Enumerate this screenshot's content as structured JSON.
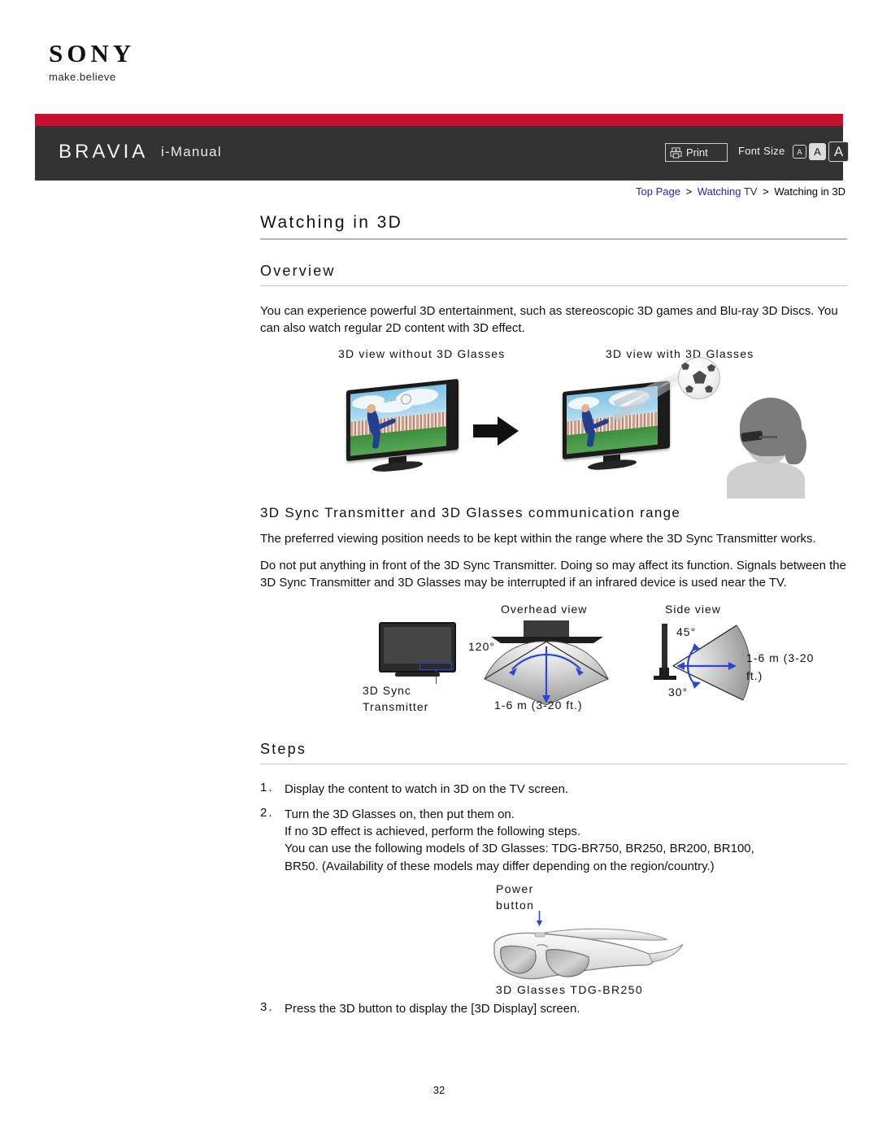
{
  "logo": {
    "brand": "SONY",
    "tagline": "make.believe"
  },
  "header": {
    "product": "BRAVIA",
    "manual": "i-Manual",
    "print_label": "Print",
    "print_icon": "printer-icon",
    "font_size_label": "Font Size",
    "font_size_options": [
      "A",
      "A",
      "A"
    ],
    "font_size_selected_index": 1,
    "bar_color": "#333333",
    "accent_color": "#c8102e"
  },
  "breadcrumb": {
    "items": [
      {
        "label": "Top Page",
        "is_link": true
      },
      {
        "label": "Watching TV",
        "is_link": true
      },
      {
        "label": "Watching in 3D",
        "is_link": false
      }
    ],
    "separator": ">",
    "link_color": "#2222cc"
  },
  "page": {
    "title": "Watching in 3D",
    "number": "32"
  },
  "overview": {
    "heading": "Overview",
    "paragraph": "You can experience powerful 3D entertainment, such as stereoscopic 3D games and Blu-ray 3D Discs. You can also watch regular 2D content with 3D effect.",
    "figure": {
      "caption_left": "3D view without 3D Glasses",
      "caption_right": "3D view with 3D Glasses"
    }
  },
  "comm_range": {
    "heading": "3D Sync Transmitter and 3D Glasses communication range",
    "paragraph_1": "The preferred viewing position needs to be kept within the range where the 3D Sync Transmitter works.",
    "paragraph_2": "Do not put anything in front of the 3D Sync Transmitter. Doing so may affect its function. Signals between the 3D Sync Transmitter and 3D Glasses may be interrupted if an infrared device is used near the TV.",
    "figure": {
      "tv_label_line1": "3D Sync",
      "tv_label_line2": "Transmitter",
      "overhead_caption": "Overhead view",
      "overhead_angle": "120°",
      "overhead_distance": "1-6 m (3-20 ft.)",
      "side_caption": "Side view",
      "side_angle_top": "45°",
      "side_angle_bottom": "30°",
      "side_distance_line1": "1-6 m (3-20",
      "side_distance_line2": "ft.)",
      "arrow_color": "#2a44dd"
    }
  },
  "steps": {
    "heading": "Steps",
    "items": [
      {
        "number": "1.",
        "lines": [
          "Display the content to watch in 3D on the TV screen."
        ]
      },
      {
        "number": "2.",
        "lines": [
          "Turn the 3D Glasses on, then put them on.",
          "If no 3D effect is achieved, perform the following steps.",
          "You can use the following models of 3D Glasses: TDG-BR750, BR250, BR200, BR100,",
          "BR50. (Availability of these models may differ depending on the region/country.)"
        ]
      },
      {
        "number": "3.",
        "lines": [
          "Press the 3D button to display the [3D Display] screen."
        ]
      }
    ]
  },
  "glasses_figure": {
    "power_label_line1": "Power",
    "power_label_line2": "button",
    "caption": "3D Glasses TDG-BR250"
  }
}
